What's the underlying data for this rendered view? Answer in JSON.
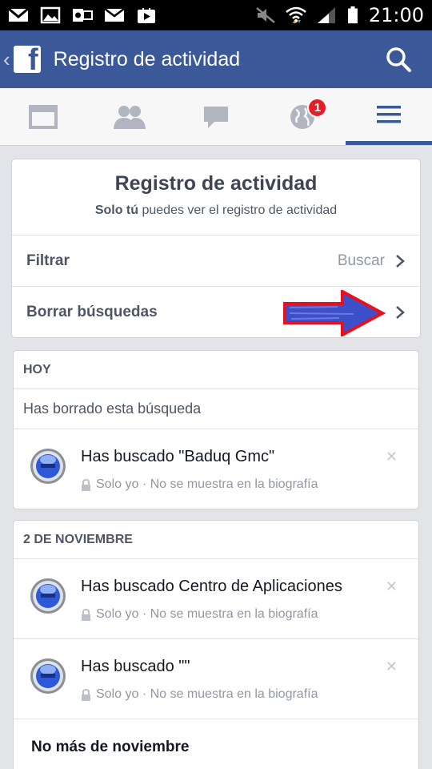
{
  "status_bar": {
    "time": "21:00"
  },
  "header": {
    "title": "Registro de actividad"
  },
  "tabs": [
    {
      "name": "feed"
    },
    {
      "name": "friends"
    },
    {
      "name": "messages"
    },
    {
      "name": "notifications",
      "badge": "1"
    },
    {
      "name": "menu"
    }
  ],
  "summary": {
    "title": "Registro de actividad",
    "subtitle_bold": "Solo tú",
    "subtitle_rest": " puedes ver el registro de actividad",
    "filter_label": "Filtrar",
    "filter_action": "Buscar",
    "clear_label": "Borrar búsquedas"
  },
  "today": {
    "heading": "HOY",
    "notice": "Has borrado esta búsqueda",
    "entries": [
      {
        "title": "Has buscado \"Baduq Gmc\"",
        "privacy": "Solo yo · No se muestra en la biografía"
      }
    ]
  },
  "november": {
    "heading": "2 DE NOVIEMBRE",
    "entries": [
      {
        "title": "Has buscado Centro de Aplicaciones",
        "privacy": "Solo yo · No se muestra en la biografía"
      },
      {
        "title": "Has buscado \"\"",
        "privacy": "Solo yo · No se muestra en la biografía"
      }
    ],
    "footer": "No más de noviembre"
  },
  "colors": {
    "brand": "#3b5998",
    "badge": "#e41e26",
    "annotation_arrow": "#e8101c"
  }
}
